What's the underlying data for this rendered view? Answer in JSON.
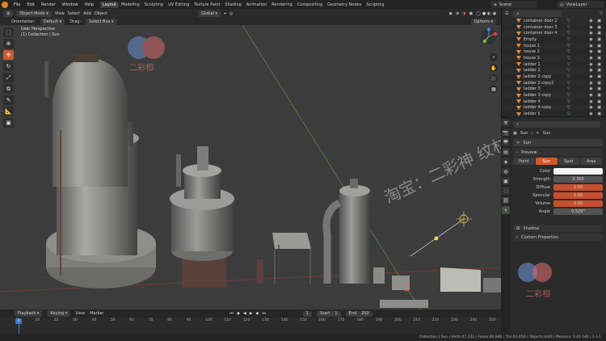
{
  "menubar": {
    "menus": [
      "File",
      "Edit",
      "Render",
      "Window",
      "Help"
    ],
    "workspaces": [
      "Layout",
      "Modeling",
      "Sculpting",
      "UV Editing",
      "Texture Paint",
      "Shading",
      "Animation",
      "Rendering",
      "Compositing",
      "Geometry Nodes",
      "Scripting"
    ],
    "active_workspace": "Layout",
    "scene": "Scene",
    "view_layer": "ViewLayer"
  },
  "viewport_header": {
    "mode": "Object Mode",
    "menus": [
      "View",
      "Select",
      "Add",
      "Object"
    ],
    "transform": "Global",
    "options": "Options"
  },
  "viewport_tools": {
    "orientation_label": "Orientation:",
    "orientation": "Default",
    "drag_label": "Drag:",
    "drag": "Select Box"
  },
  "viewport": {
    "perspective": "User Perspective",
    "collection": "(1) Collection | Sun"
  },
  "watermark": {
    "text": "淘宝：二彩神 纹材",
    "logo_text": "二彩相"
  },
  "outliner": {
    "items": [
      {
        "name": "container door 2",
        "selected": false
      },
      {
        "name": "container door 3",
        "selected": false
      },
      {
        "name": "container door 4",
        "selected": false
      },
      {
        "name": "Empty",
        "selected": false
      },
      {
        "name": "house 1",
        "selected": false
      },
      {
        "name": "house 2",
        "selected": false
      },
      {
        "name": "house 3",
        "selected": false
      },
      {
        "name": "ladder 1",
        "selected": false
      },
      {
        "name": "ladder 2",
        "selected": false
      },
      {
        "name": "ladder 2 copy",
        "selected": false
      },
      {
        "name": "ladder 2 copy2",
        "selected": false
      },
      {
        "name": "ladder 3",
        "selected": false
      },
      {
        "name": "ladder 3 copy",
        "selected": false
      },
      {
        "name": "ladder 4",
        "selected": false
      },
      {
        "name": "ladder 4 copy",
        "selected": false
      },
      {
        "name": "ladder 5",
        "selected": false
      }
    ]
  },
  "properties": {
    "breadcrumb_object": "Sun",
    "breadcrumb_data": "Sun",
    "data_name": "Sun",
    "preview": "Preview",
    "light_types": [
      "Point",
      "Sun",
      "Spot",
      "Area"
    ],
    "active_light_type": "Sun",
    "fields": [
      {
        "label": "Color",
        "value": "",
        "kind": "white"
      },
      {
        "label": "Strength",
        "value": "9.300",
        "kind": "grey"
      },
      {
        "label": "Diffuse",
        "value": "1.00",
        "kind": "orange"
      },
      {
        "label": "Specular",
        "value": "1.00",
        "kind": "orange"
      },
      {
        "label": "Volume",
        "value": "1.00",
        "kind": "orange"
      },
      {
        "label": "Angle",
        "value": "0.526°",
        "kind": "grey"
      }
    ],
    "shadow": "Shadow",
    "custom_properties": "Custom Properties"
  },
  "timeline": {
    "playback": "Playback",
    "keying": "Keying",
    "view": "View",
    "marker": "Marker",
    "current_frame": "1",
    "start_label": "Start",
    "start": "1",
    "end_label": "End",
    "end": "250",
    "ticks": [
      "1",
      "10",
      "20",
      "30",
      "40",
      "50",
      "60",
      "70",
      "80",
      "90",
      "100",
      "110",
      "120",
      "130",
      "140",
      "150",
      "160",
      "170",
      "180",
      "190",
      "200",
      "210",
      "220",
      "230",
      "240",
      "250"
    ]
  },
  "statusbar": {
    "text": "Collection | Sun | Verts:47,232 | Faces:46,846 | Tris:91,656 | Objects:0/40 | Memory: 3.41 GiB | 3.3.1"
  },
  "colors": {
    "accent": "#d0592d",
    "viewport": "#3c3c3c",
    "panel": "#2b2b2b"
  }
}
